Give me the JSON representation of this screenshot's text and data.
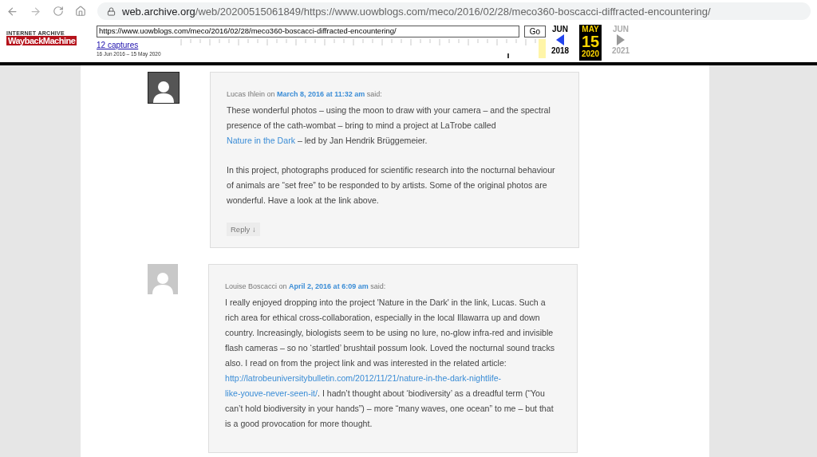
{
  "browser": {
    "host": "web.archive.org",
    "path": "/web/20200515061849/https://www.uowblogs.com/meco/2016/02/28/meco360-boscacci-diffracted-encountering/"
  },
  "wayback": {
    "logo_top": "INTERNET ARCHIVE",
    "logo": "WaybackMachine",
    "url": "https://www.uowblogs.com/meco/2016/02/28/meco360-boscacci-diffracted-encountering/",
    "go": "Go",
    "captures": "12 captures",
    "range": "16 Jun 2016 – 15 May 2020",
    "calendar": [
      {
        "month": "JUN",
        "year": "2018",
        "selected": false,
        "disabled": false
      },
      {
        "month": "MAY",
        "day": "15",
        "year": "2020",
        "selected": true,
        "disabled": false
      },
      {
        "month": "JUN",
        "year": "2021",
        "selected": false,
        "disabled": true
      }
    ]
  },
  "comments": [
    {
      "kind": "dark",
      "author": "Lucas Ihlein",
      "on": "on",
      "date": "March 8, 2016 at 11:32 am",
      "said": "said:",
      "paragraphs": [
        [
          {
            "kind": "text",
            "text": "These wonderful photos – using the moon to draw with your camera – and the spectral presence of the cath-wombat – bring to mind a project at LaTrobe called "
          },
          {
            "kind": "link",
            "text": "Nature in the Dark"
          },
          {
            "kind": "text",
            "text": " – led by Jan Hendrik Brüggemeier."
          }
        ],
        [
          {
            "kind": "text",
            "text": "In this project, photographs produced for scientific research into the nocturnal behaviour of animals are “set free” to be responded to by artists. Some of the original photos are wonderful. Have a look at the link above."
          }
        ]
      ],
      "reply": "Reply ↓"
    },
    {
      "kind": "light",
      "author": "Louise Boscacci",
      "on": "on",
      "date": "April 2, 2016 at 6:09 am",
      "said": "said:",
      "paragraphs": [
        [
          {
            "kind": "text",
            "text": "I really enjoyed dropping into the project 'Nature in the Dark' in the link, Lucas. Such a rich area for ethical cross-collaboration, especially in the local Illawarra up and down country. Increasingly, biologists seem to be using no lure, no-glow infra-red and invisible flash cameras – so no ‘startled’ brushtail possum look. Loved the nocturnal sound tracks also. I read on from the project link and was interested in the related article: "
          },
          {
            "kind": "link",
            "text": "http://latrobeuniversitybulletin.com/2012/11/21/nature-in-the-dark-nightlife-"
          },
          {
            "kind": "link",
            "text": "like-youve-never-seen-it/"
          },
          {
            "kind": "text",
            "text": ". I hadn’t thought about ‘biodiversity’ as a dreadful term (“You can’t hold biodiversity in your hands”) – more “many waves, one ocean” to me – but that is a good provocation for more thought."
          }
        ]
      ]
    }
  ]
}
